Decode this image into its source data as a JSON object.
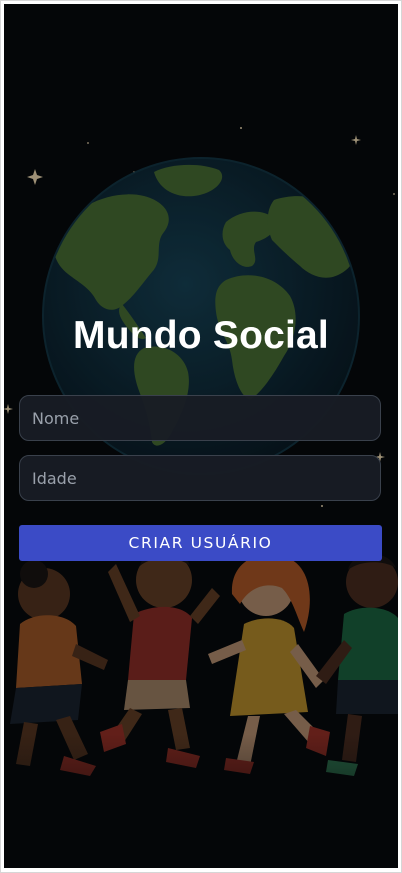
{
  "app": {
    "title": "Mundo Social"
  },
  "form": {
    "name_placeholder": "Nome",
    "name_value": "",
    "age_placeholder": "Idade",
    "age_value": "",
    "submit_label": "CRIAR USUÁRIO"
  },
  "colors": {
    "background": "#040608",
    "button": "#3b4bc6",
    "title_text": "#ffffff",
    "input_background": "#181c24",
    "input_border": "#3a414c"
  }
}
